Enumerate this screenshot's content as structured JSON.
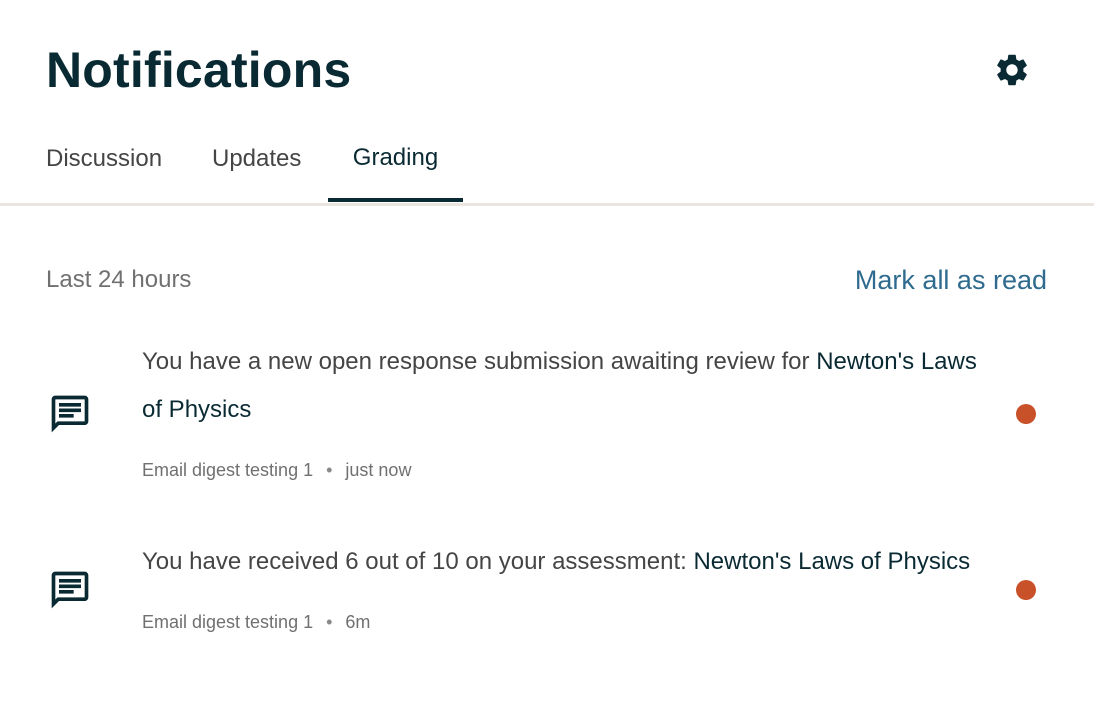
{
  "header": {
    "title": "Notifications",
    "settings_icon": "gear-icon"
  },
  "tabs": [
    {
      "label": "Discussion",
      "active": false
    },
    {
      "label": "Updates",
      "active": false
    },
    {
      "label": "Grading",
      "active": true
    }
  ],
  "section": {
    "label": "Last 24 hours",
    "mark_all_label": "Mark all as read"
  },
  "notifications": [
    {
      "icon": "chat-icon",
      "text": "You have a new open response submission awaiting review for ",
      "link": "Newton's Laws of Physics",
      "source": "Email digest testing 1",
      "separator": "•",
      "time": "just now",
      "unread": true
    },
    {
      "icon": "chat-icon",
      "text": "You have received 6 out of 10 on your assessment: ",
      "link": "Newton's Laws of Physics",
      "source": "Email digest testing 1",
      "separator": "•",
      "time": "6m",
      "unread": true
    }
  ],
  "colors": {
    "title": "#0a2a33",
    "accent_link": "#2e6b8e",
    "unread": "#c9512a",
    "tab_underline": "#0a2a33",
    "divider": "#eae6df"
  }
}
